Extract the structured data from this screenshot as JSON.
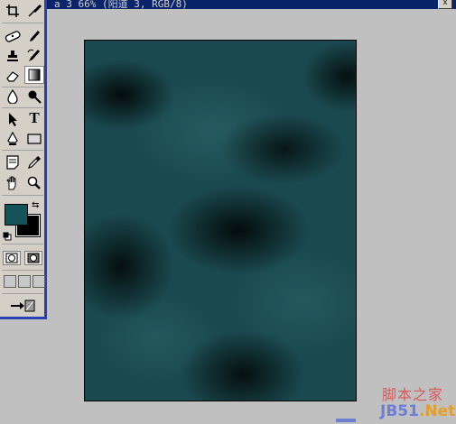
{
  "window": {
    "title": "a 3 66% (阳道 3, RGB/8)",
    "close_label": "x"
  },
  "toolbox": {
    "type_tool_label": "T",
    "tools": [
      "crop-icon",
      "slice-icon",
      "healing-brush-icon",
      "brush-icon",
      "clone-stamp-icon",
      "history-brush-icon",
      "eraser-icon",
      "gradient-icon",
      "blur-icon",
      "dodge-icon",
      "path-select-icon",
      "type-icon",
      "pen-icon",
      "shape-icon",
      "notes-icon",
      "eyedropper-icon",
      "hand-icon",
      "zoom-icon"
    ],
    "foreground_color": "#15535a",
    "background_color": "#000000"
  },
  "canvas": {
    "texture": "clouds-teal",
    "base_color": "#1a4a50"
  },
  "watermark": {
    "site_cn": "脚本之家",
    "url_part1": "JB51",
    "url_part2": ".Net"
  }
}
